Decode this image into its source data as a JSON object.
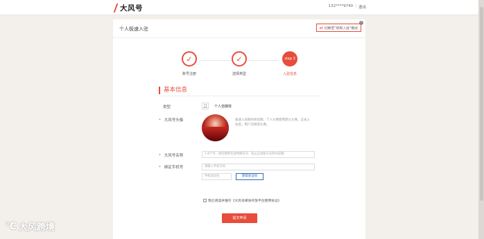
{
  "brand": {
    "logo_text": "大风号",
    "accent": "#e74c3c"
  },
  "user": {
    "phone": "132****9740",
    "logout": "退出"
  },
  "panel": {
    "title": "个人极速入驻",
    "switch_label": "切换至“机构入驻”模式",
    "help": "?"
  },
  "steps": [
    {
      "label": "账号注册",
      "state": "done",
      "mark": "✓"
    },
    {
      "label": "选择类型",
      "state": "done",
      "mark": "✓"
    },
    {
      "label": "入驻信息",
      "state": "active",
      "mark": "step 3"
    }
  ],
  "form": {
    "section_title": "基本信息",
    "type_label": "类型",
    "type_value": "个人自媒体",
    "avatar_label": "大风号头像",
    "avatar_tip": "极速入驻期间体验期，个人头像使用默认头像，正式入驻后，用户可修改头像。",
    "name_label": "大风号名称",
    "name_placeholder": "1-8个字，请勿使用包含特殊符号、或以正式账号名称为前缀",
    "phone_label": "绑定手机号",
    "phone_placeholder": "请输入手机号码",
    "code_placeholder": "手机验证码",
    "code_button": "获取验证码",
    "agree_text": "我已阅读并遵守《大风号媒体开放平台使用协议》",
    "submit": "提交申请"
  },
  "watermark": {
    "text": "大风跨境"
  }
}
